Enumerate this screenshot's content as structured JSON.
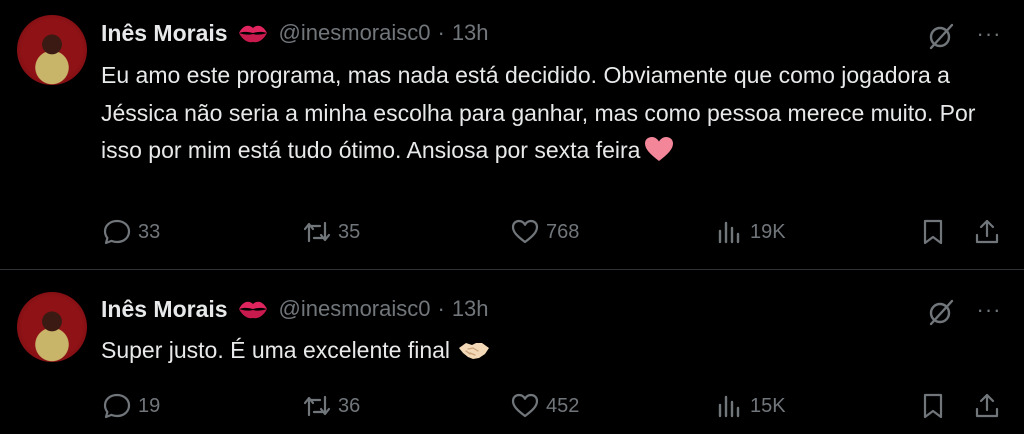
{
  "tweets": [
    {
      "author_name": "Inês Morais",
      "handle": "@inesmoraisc0",
      "separator": "·",
      "time": "13h",
      "text": "Eu amo este programa, mas nada está decidido. Obviamente que como jogadora a Jéssica não seria a minha escolha para ganhar, mas como pessoa merece muito. Por isso por mim está tudo ótimo. Ansiosa por sexta feira",
      "emoji": "pink-heart",
      "stats": {
        "replies": "33",
        "reposts": "35",
        "likes": "768",
        "views": "19K"
      }
    },
    {
      "author_name": "Inês Morais",
      "handle": "@inesmoraisc0",
      "separator": "·",
      "time": "13h",
      "text": "Super justo. É uma excelente final",
      "emoji": "handshake",
      "stats": {
        "replies": "19",
        "reposts": "36",
        "likes": "452",
        "views": "15K"
      }
    }
  ],
  "more_label": "···",
  "colors": {
    "background": "#000000",
    "text": "#e7e9ea",
    "muted": "#71767b",
    "divider": "#2f3336",
    "heart": "#f4869a"
  }
}
